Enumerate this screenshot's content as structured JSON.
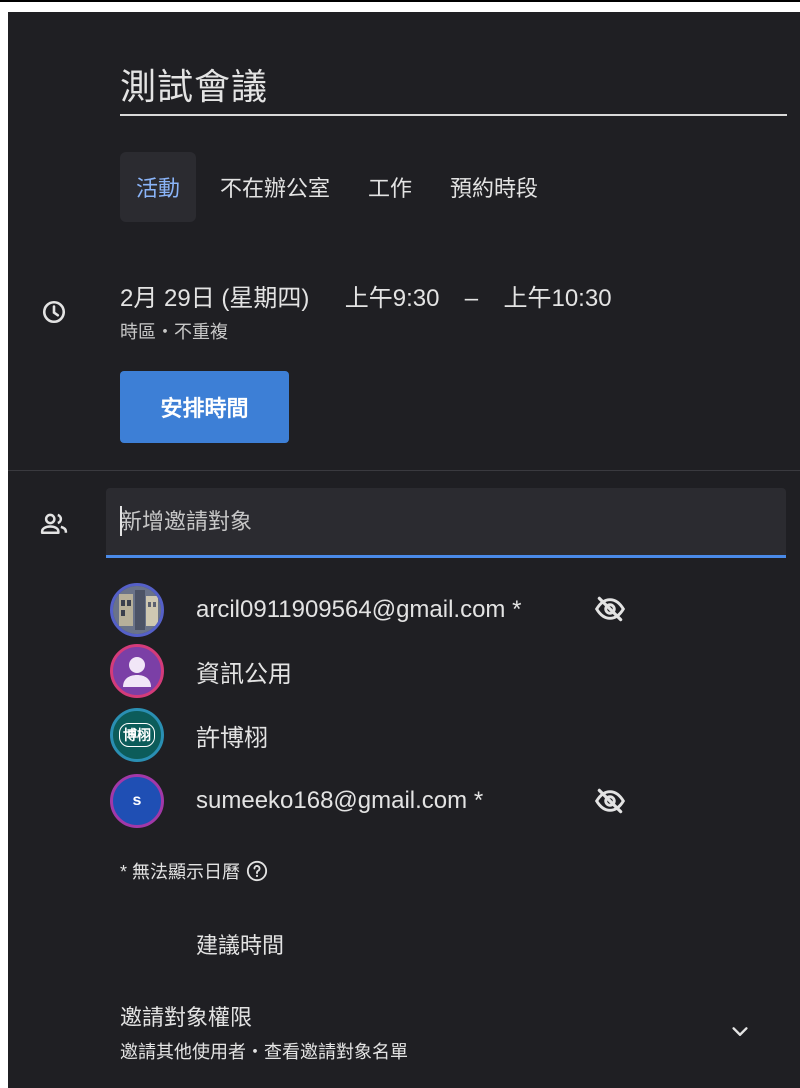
{
  "event": {
    "title": "測試會議"
  },
  "tabs": [
    {
      "label": "活動",
      "active": true
    },
    {
      "label": "不在辦公室",
      "active": false
    },
    {
      "label": "工作",
      "active": false
    },
    {
      "label": "預約時段",
      "active": false
    }
  ],
  "datetime": {
    "date": "2月 29日 (星期四)",
    "start": "上午9:30",
    "separator": "–",
    "end": "上午10:30",
    "timezone_repeat": "時區・不重複"
  },
  "schedule_button": {
    "label": "安排時間"
  },
  "guests": {
    "input_placeholder": "新增邀請對象",
    "list": [
      {
        "name": "arcil0911909564@gmail.com *",
        "avatar_type": "photo",
        "calendar_hidden": true
      },
      {
        "name": "資訊公用",
        "avatar_type": "default-person",
        "calendar_hidden": false
      },
      {
        "name": "許博栩",
        "avatar_type": "text",
        "avatar_text": "博栩",
        "calendar_hidden": false
      },
      {
        "name": "sumeeko168@gmail.com *",
        "avatar_type": "initial",
        "avatar_text": "s",
        "calendar_hidden": true
      }
    ],
    "note": "* 無法顯示日曆"
  },
  "suggest_times": {
    "label": "建議時間"
  },
  "permissions": {
    "title": "邀請對象權限",
    "subtitle": "邀請其他使用者・查看邀請對象名單"
  },
  "colors": {
    "background": "#1f1f23",
    "accent": "#8ab4f8",
    "button": "#3d7fd6",
    "input_underline": "#4a8ae8"
  }
}
